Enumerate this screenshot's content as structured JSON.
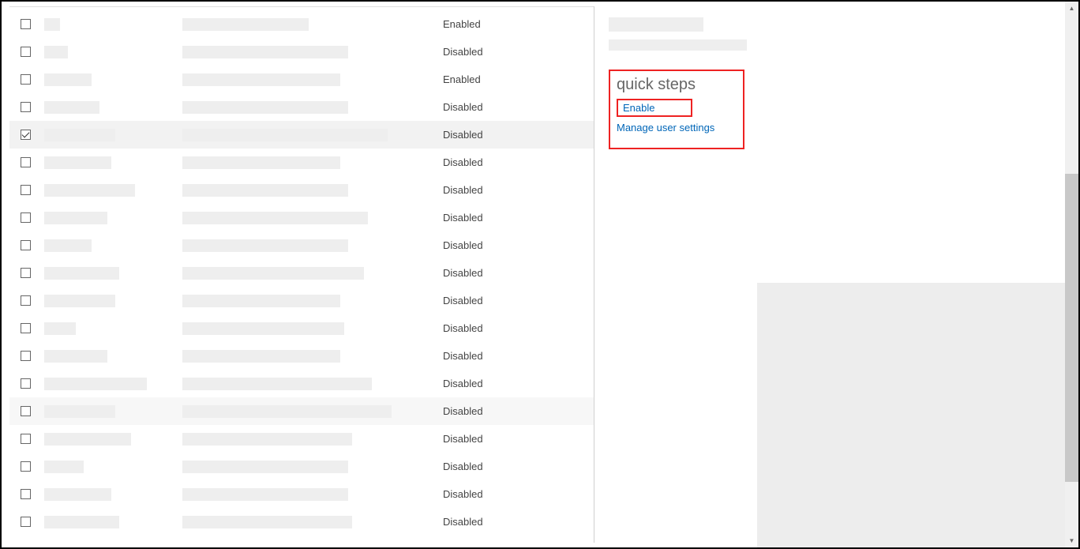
{
  "status_enabled": "Enabled",
  "status_disabled": "Disabled",
  "rows": [
    {
      "status": "Enabled",
      "selected": false,
      "name_w": 20,
      "upn_w": 160
    },
    {
      "status": "Disabled",
      "selected": false,
      "name_w": 30,
      "upn_w": 210
    },
    {
      "status": "Enabled",
      "selected": false,
      "name_w": 60,
      "upn_w": 200
    },
    {
      "status": "Disabled",
      "selected": false,
      "name_w": 70,
      "upn_w": 210
    },
    {
      "status": "Disabled",
      "selected": true,
      "name_w": 90,
      "upn_w": 260
    },
    {
      "status": "Disabled",
      "selected": false,
      "name_w": 85,
      "upn_w": 200
    },
    {
      "status": "Disabled",
      "selected": false,
      "name_w": 115,
      "upn_w": 210
    },
    {
      "status": "Disabled",
      "selected": false,
      "name_w": 80,
      "upn_w": 235
    },
    {
      "status": "Disabled",
      "selected": false,
      "name_w": 60,
      "upn_w": 210
    },
    {
      "status": "Disabled",
      "selected": false,
      "name_w": 95,
      "upn_w": 230
    },
    {
      "status": "Disabled",
      "selected": false,
      "name_w": 90,
      "upn_w": 200
    },
    {
      "status": "Disabled",
      "selected": false,
      "name_w": 40,
      "upn_w": 205
    },
    {
      "status": "Disabled",
      "selected": false,
      "name_w": 80,
      "upn_w": 200
    },
    {
      "status": "Disabled",
      "selected": false,
      "name_w": 130,
      "upn_w": 240
    },
    {
      "status": "Disabled",
      "selected": false,
      "hover": true,
      "name_w": 90,
      "upn_w": 265
    },
    {
      "status": "Disabled",
      "selected": false,
      "name_w": 110,
      "upn_w": 215
    },
    {
      "status": "Disabled",
      "selected": false,
      "name_w": 50,
      "upn_w": 210
    },
    {
      "status": "Disabled",
      "selected": false,
      "name_w": 85,
      "upn_w": 210
    },
    {
      "status": "Disabled",
      "selected": false,
      "name_w": 95,
      "upn_w": 215
    }
  ],
  "side_panel": {
    "quick_steps_title": "quick steps",
    "enable_link": "Enable",
    "manage_link": "Manage user settings"
  }
}
